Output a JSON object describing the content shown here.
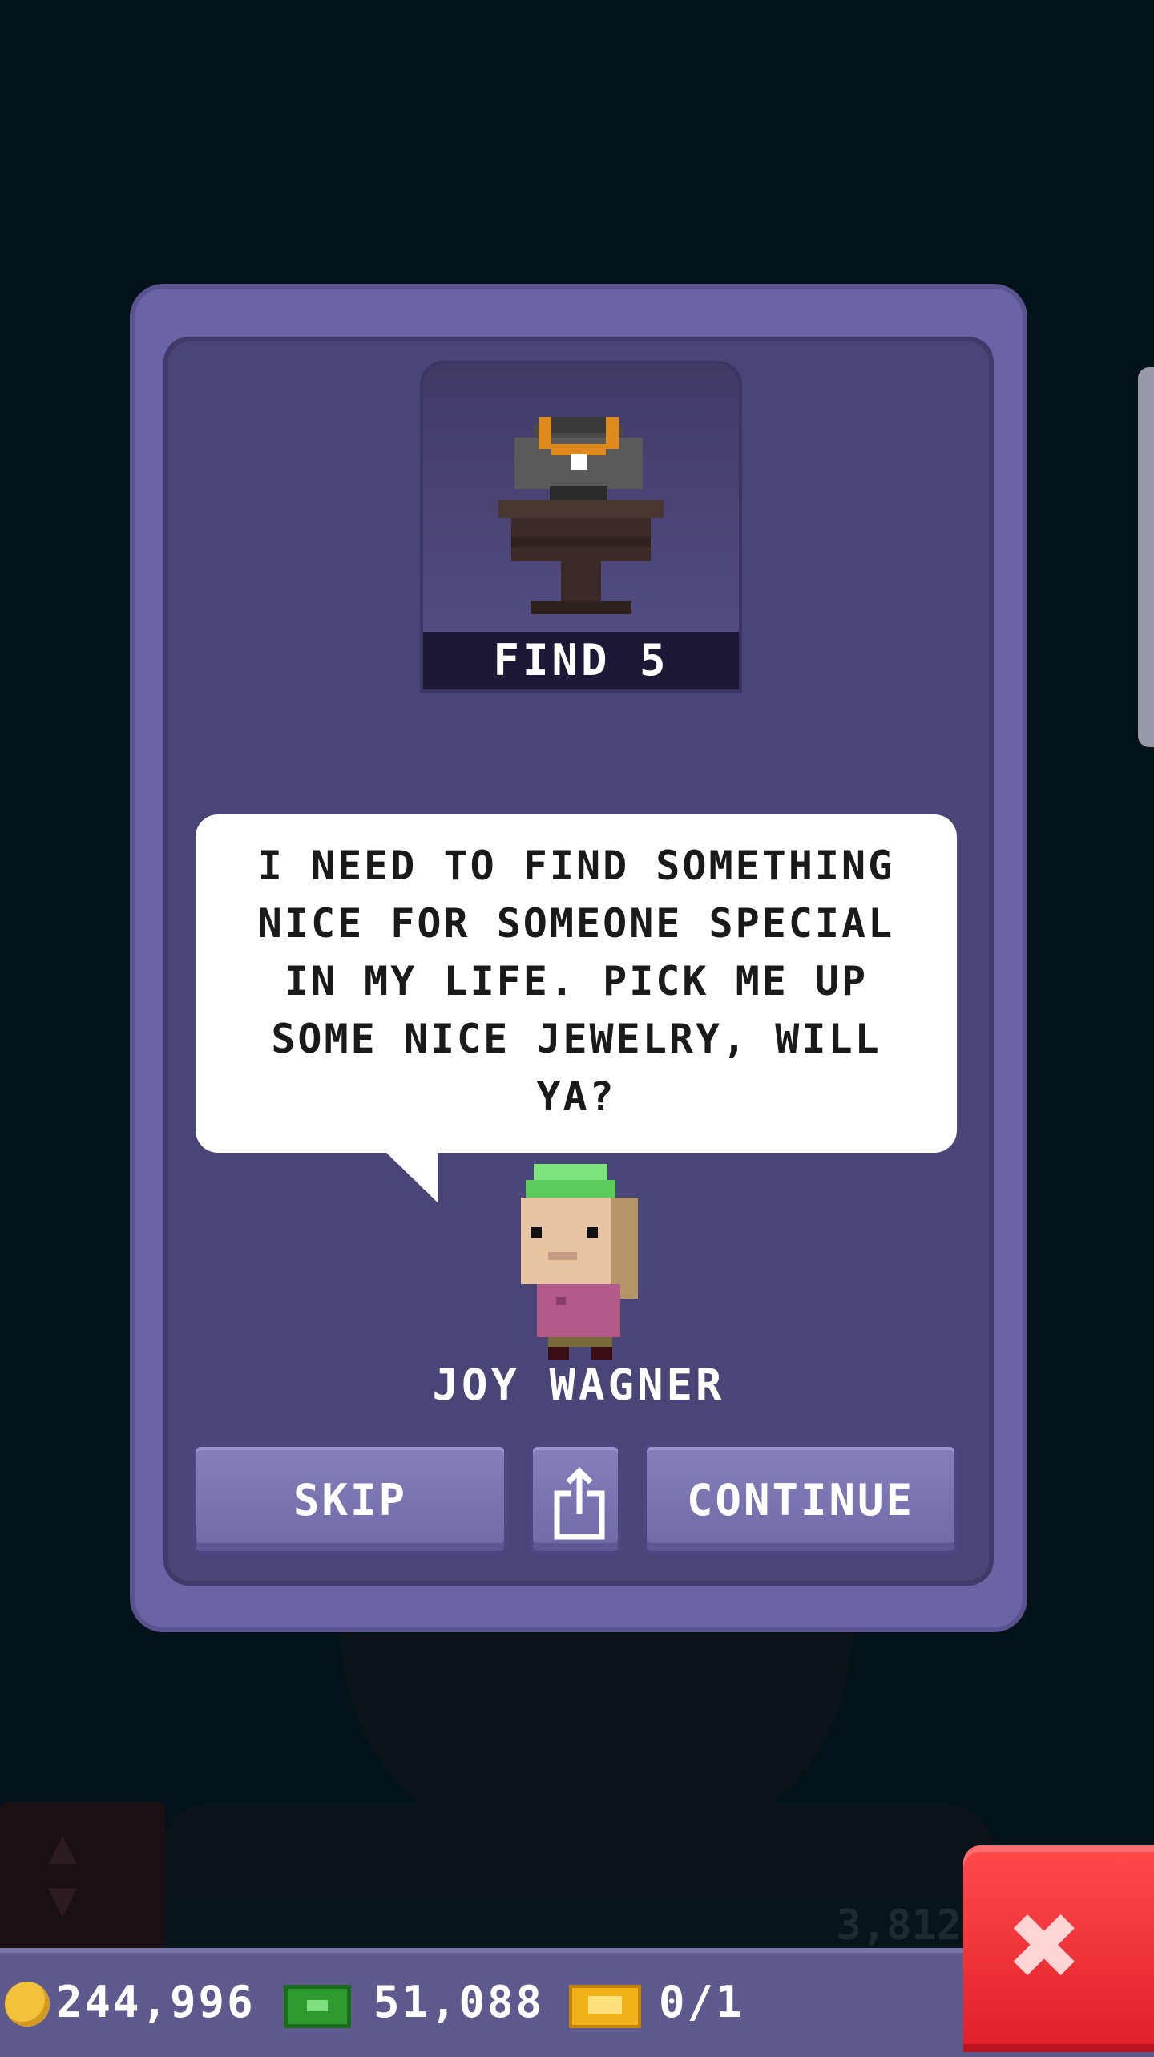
{
  "quest": {
    "objective": "FIND 5",
    "dialog": "I NEED TO FIND SOMETHING\nNICE FOR SOMEONE SPECIAL\nIN MY LIFE. PICK ME UP\nSOME NICE JEWELRY, WILL\nYA?",
    "character_name": "JOY WAGNER",
    "item_icon": "jewelry-pedestal-icon"
  },
  "buttons": {
    "skip": "SKIP",
    "share_icon": "share-icon",
    "continue": "CONTINUE"
  },
  "hud": {
    "coins": "244,996",
    "bux": "51,088",
    "tickets": "0/1",
    "close_icon": "close-icon"
  },
  "background": {
    "partial_label": "3,812"
  },
  "colors": {
    "dialog_frame": "#6a63a4",
    "dialog_inner": "#4a4577",
    "close_button": "#e01f2a",
    "hud_bar": "#5e5a8e"
  }
}
